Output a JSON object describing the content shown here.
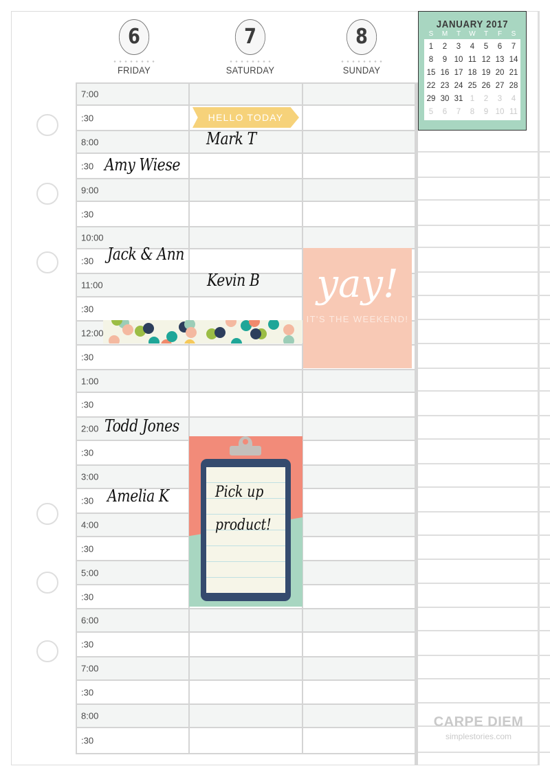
{
  "days": [
    {
      "number": "6",
      "name": "FRIDAY"
    },
    {
      "number": "7",
      "name": "SATURDAY"
    },
    {
      "number": "8",
      "name": "SUNDAY"
    }
  ],
  "time_slots": [
    {
      "label": "7:00",
      "type": "hour"
    },
    {
      "label": ":30",
      "type": "half"
    },
    {
      "label": "8:00",
      "type": "hour"
    },
    {
      "label": ":30",
      "type": "half"
    },
    {
      "label": "9:00",
      "type": "hour"
    },
    {
      "label": ":30",
      "type": "half"
    },
    {
      "label": "10:00",
      "type": "hour"
    },
    {
      "label": ":30",
      "type": "half"
    },
    {
      "label": "11:00",
      "type": "hour"
    },
    {
      "label": ":30",
      "type": "half"
    },
    {
      "label": "12:00",
      "type": "hour"
    },
    {
      "label": ":30",
      "type": "half"
    },
    {
      "label": "1:00",
      "type": "hour"
    },
    {
      "label": ":30",
      "type": "half"
    },
    {
      "label": "2:00",
      "type": "hour"
    },
    {
      "label": ":30",
      "type": "half"
    },
    {
      "label": "3:00",
      "type": "hour"
    },
    {
      "label": ":30",
      "type": "half"
    },
    {
      "label": "4:00",
      "type": "hour"
    },
    {
      "label": ":30",
      "type": "half"
    },
    {
      "label": "5:00",
      "type": "hour"
    },
    {
      "label": ":30",
      "type": "half"
    },
    {
      "label": "6:00",
      "type": "hour"
    },
    {
      "label": ":30",
      "type": "half"
    },
    {
      "label": "7:00",
      "type": "hour"
    },
    {
      "label": ":30",
      "type": "half"
    },
    {
      "label": "8:00",
      "type": "hour"
    },
    {
      "label": ":30",
      "type": "half"
    }
  ],
  "entries": {
    "friday": [
      "Amy Wiese",
      "Jack & Ann",
      "Todd Jones",
      "Amelia K"
    ],
    "saturday": [
      "Mark T",
      "Kevin B"
    ]
  },
  "stickers": {
    "banner": "HELLO TODAY",
    "yay_title": "yay!",
    "yay_subtitle": "IT'S THE WEEKEND!",
    "clipboard_note_line1": "Pick up",
    "clipboard_note_line2": "product!"
  },
  "mini_calendar": {
    "title": "JANUARY 2017",
    "weekdays": [
      "S",
      "M",
      "T",
      "W",
      "T",
      "F",
      "S"
    ],
    "days": [
      {
        "d": "1"
      },
      {
        "d": "2"
      },
      {
        "d": "3"
      },
      {
        "d": "4"
      },
      {
        "d": "5"
      },
      {
        "d": "6"
      },
      {
        "d": "7"
      },
      {
        "d": "8"
      },
      {
        "d": "9"
      },
      {
        "d": "10"
      },
      {
        "d": "11"
      },
      {
        "d": "12"
      },
      {
        "d": "13"
      },
      {
        "d": "14"
      },
      {
        "d": "15"
      },
      {
        "d": "16"
      },
      {
        "d": "17"
      },
      {
        "d": "18"
      },
      {
        "d": "19"
      },
      {
        "d": "20"
      },
      {
        "d": "21"
      },
      {
        "d": "22"
      },
      {
        "d": "23"
      },
      {
        "d": "24"
      },
      {
        "d": "25"
      },
      {
        "d": "26"
      },
      {
        "d": "27"
      },
      {
        "d": "28"
      },
      {
        "d": "29"
      },
      {
        "d": "30"
      },
      {
        "d": "31"
      },
      {
        "d": "1",
        "muted": true
      },
      {
        "d": "2",
        "muted": true
      },
      {
        "d": "3",
        "muted": true
      },
      {
        "d": "4",
        "muted": true
      },
      {
        "d": "5",
        "muted": true
      },
      {
        "d": "6",
        "muted": true
      },
      {
        "d": "7",
        "muted": true
      },
      {
        "d": "8",
        "muted": true
      },
      {
        "d": "9",
        "muted": true
      },
      {
        "d": "10",
        "muted": true
      },
      {
        "d": "11",
        "muted": true
      }
    ]
  },
  "footer": {
    "brand": "CARPE DIEM",
    "website": "simplestories.com"
  },
  "colors": {
    "banner": "#f6d27a",
    "yay_card": "#f8c9b5",
    "clipboard_coral": "#f28b79",
    "clipboard_mint": "#a8d6c1",
    "clipboard_board": "#354b6e",
    "calendar_mint": "#a8d6c1",
    "hour_row": "#f3f5f4",
    "grid_line": "#d4d4d4"
  }
}
